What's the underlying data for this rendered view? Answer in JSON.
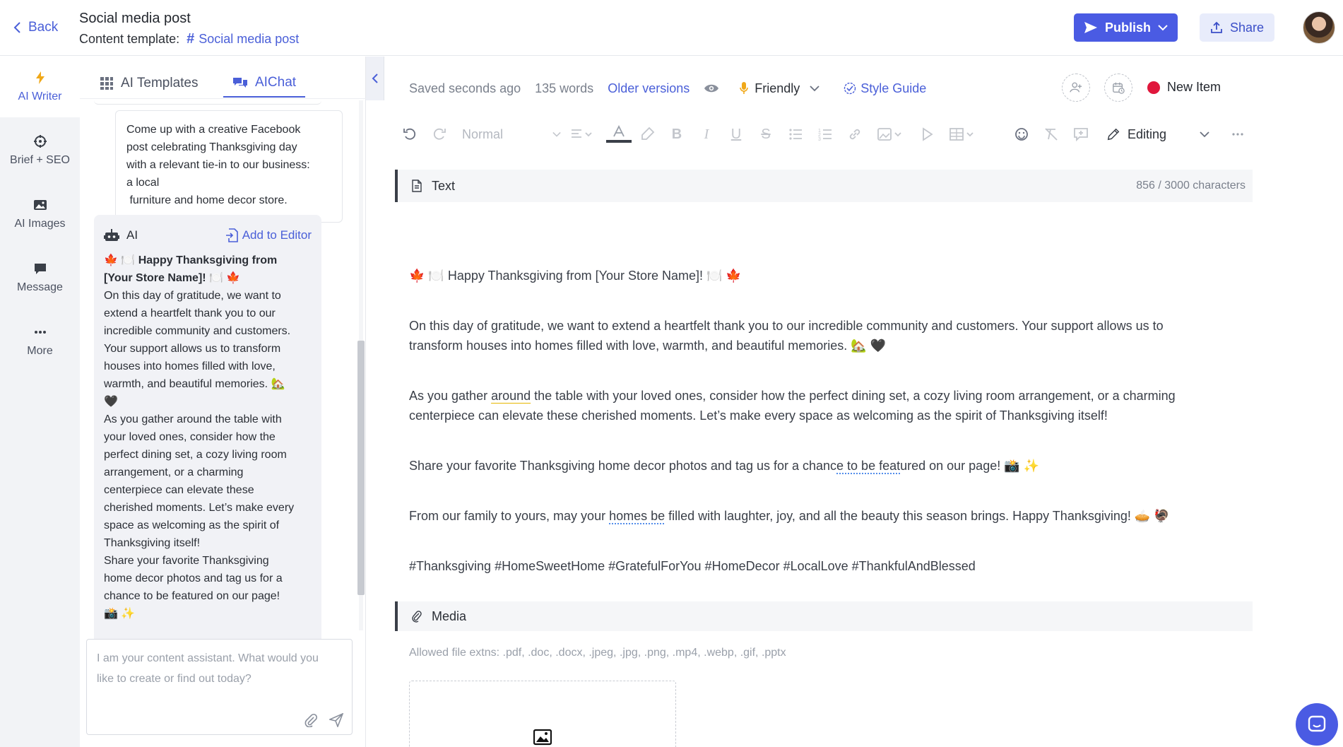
{
  "header": {
    "back_label": "Back",
    "title": "Social media post",
    "template_label": "Content template:",
    "template_name": "Social media post",
    "publish_label": "Publish",
    "share_label": "Share"
  },
  "leftnav": {
    "items": [
      {
        "label": "AI Writer",
        "icon": "lightning-icon",
        "active": true
      },
      {
        "label": "Brief + SEO",
        "icon": "target-icon"
      },
      {
        "label": "AI Images",
        "icon": "image-icon"
      },
      {
        "label": "Message",
        "icon": "message-icon"
      },
      {
        "label": "More",
        "icon": "more-icon"
      }
    ]
  },
  "assistant": {
    "tabs": [
      {
        "label": "AI Templates",
        "icon": "grid-icon"
      },
      {
        "label": "AIChat",
        "icon": "chat-icon",
        "active": true
      }
    ],
    "user_message_lines": [
      "Come up with a creative Facebook",
      "post celebrating Thanksgiving day",
      "with a relevant tie-in to our business:",
      "a local",
      " furniture and home decor store."
    ],
    "ai_label": "AI",
    "add_to_editor": "Add to Editor",
    "ai_heading_lines": [
      "🍁 🍽️ Happy Thanksgiving from",
      "[Your Store Name]! 🍽️ 🍁"
    ],
    "ai_body_lines": [
      "On this day of gratitude, we want to",
      "extend a heartfelt thank you to our",
      "incredible community and customers.",
      "Your support allows us to transform",
      "houses into homes filled with love,",
      "warmth, and beautiful memories. 🏡",
      "🖤",
      "As you gather around the table with",
      "your loved ones, consider how the",
      "perfect dining set, a cozy living room",
      "arrangement, or a charming",
      "centerpiece can elevate these",
      "cherished moments. Let’s make every",
      "space as welcoming as the spirit of",
      "Thanksgiving itself!",
      "Share your favorite Thanksgiving",
      "home decor photos and tag us for a",
      "chance to be featured on our page!",
      "📸 ✨"
    ],
    "input_placeholder_lines": [
      "I am your content assistant. What would you",
      "like to create or find out today?"
    ]
  },
  "editor": {
    "saved_status": "Saved seconds ago",
    "word_count": "135 words",
    "older_versions": "Older versions",
    "tone": "Friendly",
    "style_guide": "Style Guide",
    "new_item": "New Item",
    "toolbar": {
      "style_value": "Normal",
      "editing_mode": "Editing"
    },
    "text_section": {
      "title": "Text",
      "char_count": "856 / 3000 characters"
    },
    "paragraphs": {
      "p1": "🍁 🍽️ Happy Thanksgiving from [Your Store Name]! 🍽️ 🍁",
      "p2_line1": "On this day of gratitude, we want to extend a heartfelt thank you to our incredible community and customers. Your support allows us to",
      "p2_line2": "transform houses into homes filled with love, warmth, and beautiful memories. 🏡 🖤",
      "p3_a": "As you gather ",
      "p3_u": "around",
      "p3_b": " the table with your loved ones, consider how the perfect dining set, a cozy living room arrangement, or a charming",
      "p3_line2": "centerpiece can elevate these cherished moments. Let’s make every space as welcoming as the spirit of Thanksgiving itself!",
      "p4_a": "Share your favorite Thanksgiving home decor photos and tag us for a chanc",
      "p4_u": "e to be feat",
      "p4_b": "ured on our page! 📸 ✨",
      "p5_a": "From our family to yours, may your ",
      "p5_u": "homes be",
      "p5_b": " filled with laughter, joy, and all the beauty this season brings. Happy Thanksgiving! 🥧 🦃",
      "p6": "#Thanksgiving #HomeSweetHome #GratefulForYou #HomeDecor #LocalLove #ThankfulAndBlessed"
    },
    "media_section": {
      "title": "Media",
      "allowed": "Allowed file extns: .pdf, .doc, .docx, .jpeg, .jpg, .png, .mp4, .webp, .gif, .pptx"
    }
  },
  "colors": {
    "accent": "#4a5be3",
    "link": "#4a5fd8",
    "new_item_dot": "#e0173c"
  }
}
